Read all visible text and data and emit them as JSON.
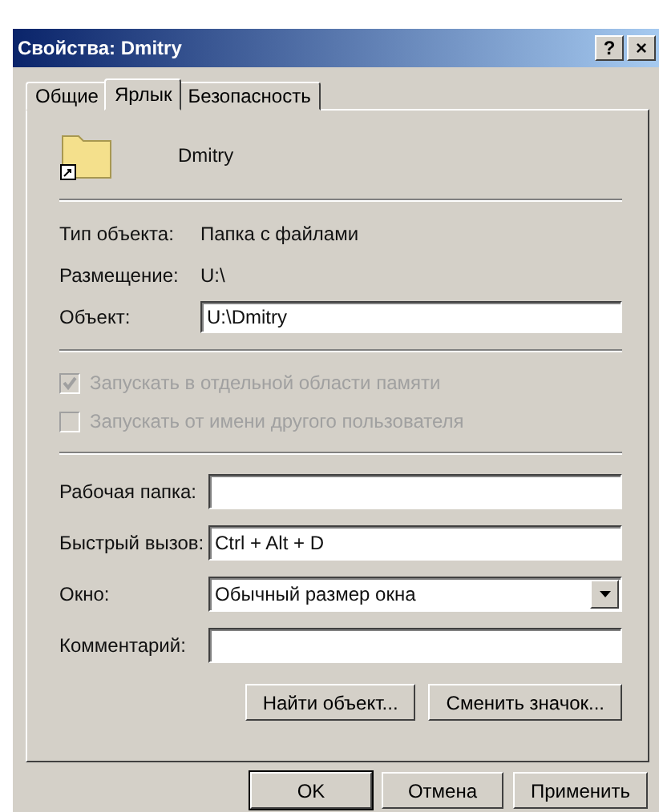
{
  "window": {
    "title": "Свойства: Dmitry",
    "help": "?",
    "close": "×"
  },
  "tabs": [
    {
      "label": "Общие",
      "selected": false
    },
    {
      "label": "Ярлык",
      "selected": true
    },
    {
      "label": "Безопасность",
      "selected": false
    }
  ],
  "header": {
    "name": "Dmitry"
  },
  "info": [
    {
      "label": "Тип объекта:",
      "value": "Папка с файлами"
    },
    {
      "label": "Размещение:",
      "value": "U:\\"
    }
  ],
  "target": {
    "label": "Объект:",
    "value": "U:\\Dmitry"
  },
  "options": [
    {
      "label": "Запускать в отдельной области памяти",
      "checked": true,
      "disabled": true
    },
    {
      "label": "Запускать от имени другого пользователя",
      "checked": false,
      "disabled": true
    }
  ],
  "fields": [
    {
      "kind": "text",
      "label": "Рабочая папка:"
    },
    {
      "kind": "text",
      "label": "Быстрый вызов:",
      "value": "Ctrl + Alt + D"
    },
    {
      "kind": "select",
      "label": "Окно:",
      "value": "Обычный размер окна"
    },
    {
      "kind": "text",
      "label": "Комментарий:"
    }
  ],
  "actions": [
    "Найти объект...",
    "Сменить значок..."
  ],
  "buttons": [
    {
      "label": "OK",
      "default": true
    },
    {
      "label": "Отмена",
      "default": false
    },
    {
      "label": "Применить",
      "default": false
    }
  ]
}
